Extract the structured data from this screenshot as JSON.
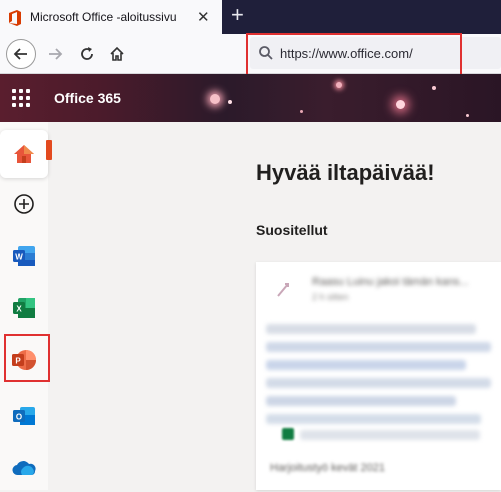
{
  "browser": {
    "tab_title": "Microsoft Office -aloitussivu",
    "close_glyph": "✕",
    "newtab_glyph": "+",
    "url": "https://www.office.com/"
  },
  "office": {
    "app_title": "Office 365",
    "greeting": "Hyvää iltapäivää!",
    "recommended_label": "Suositellut",
    "card_title": "Raasu Luinu jakoi tämän kans...",
    "card_subtitle": "2 h sitten",
    "card_footer": "Harjoitustyö kevät 2021"
  },
  "rail": {
    "items": [
      "home",
      "create",
      "word",
      "excel",
      "powerpoint",
      "outlook",
      "onedrive"
    ]
  },
  "colors": {
    "highlight": "#e03131",
    "word": "#185abd",
    "excel": "#107c41",
    "powerpoint": "#c43e1c",
    "outlook": "#0f6cbd",
    "onedrive": "#0f6cbd"
  }
}
